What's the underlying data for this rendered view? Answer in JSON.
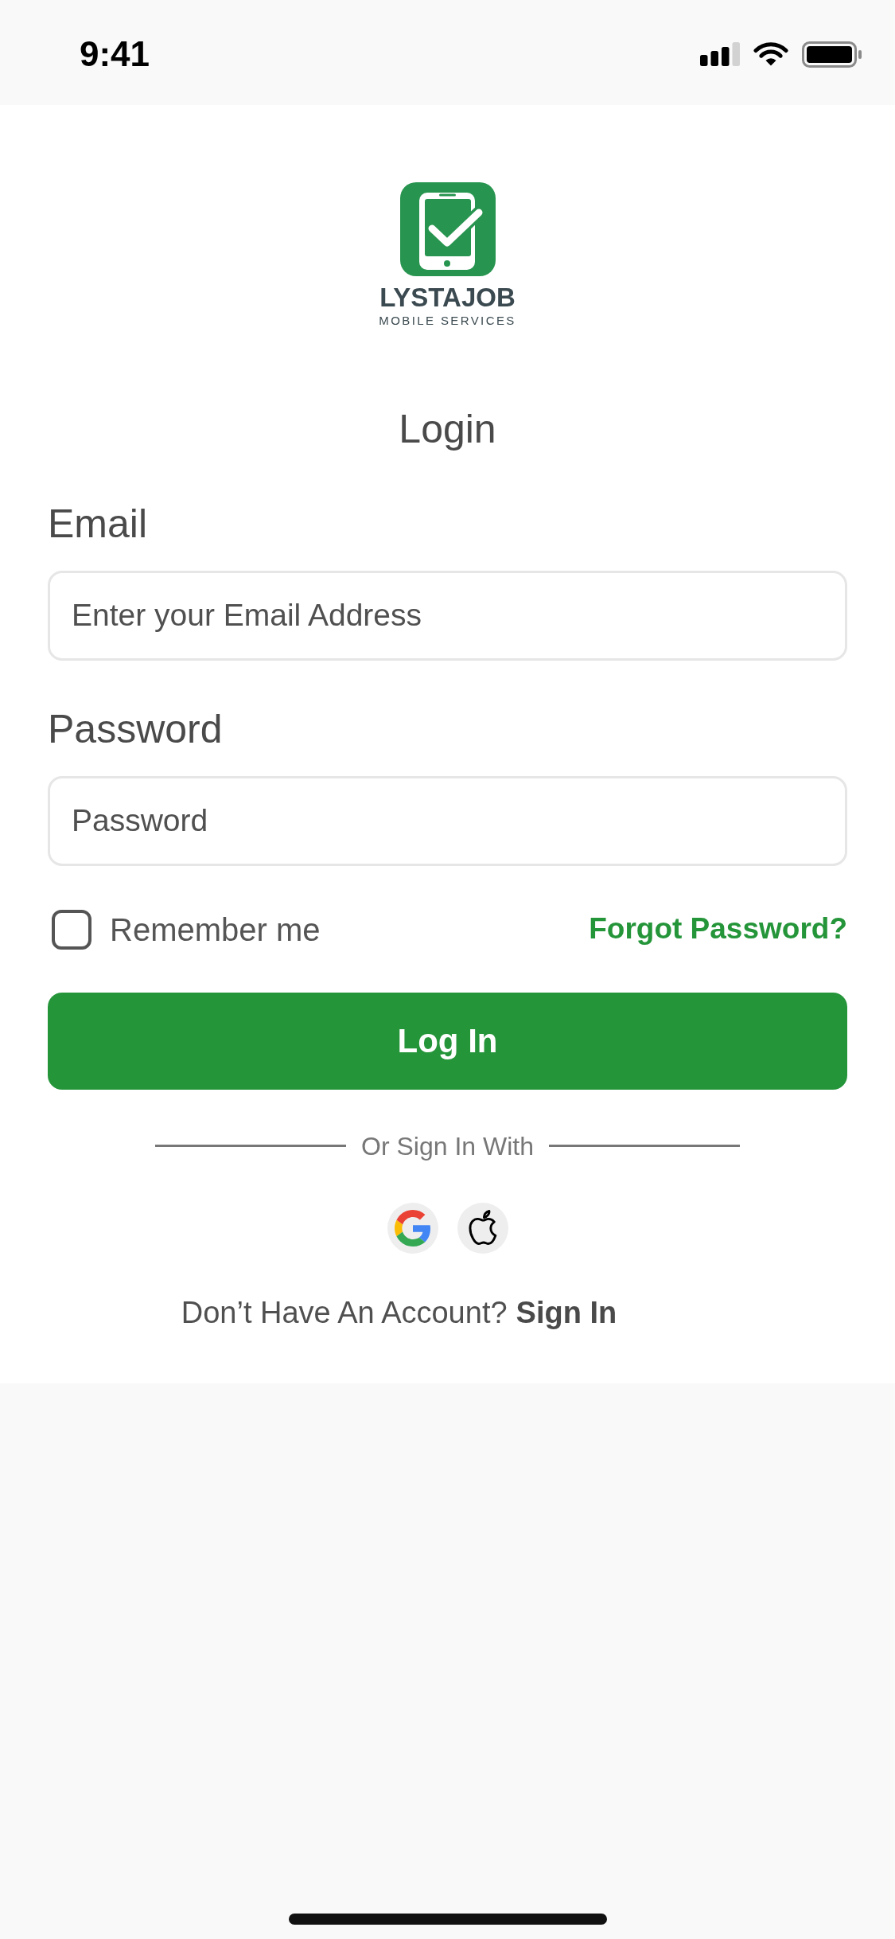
{
  "status_bar": {
    "time": "9:41"
  },
  "brand": {
    "name": "LYSTAJOB",
    "tagline": "MOBILE SERVICES"
  },
  "title": "Login",
  "fields": [
    {
      "label": "Email",
      "placeholder": "Enter your Email Address"
    },
    {
      "label": "Password",
      "placeholder": "Password"
    }
  ],
  "remember": {
    "label": "Remember me",
    "checked": false
  },
  "forgot_link": "Forgot Password?",
  "login_button": "Log In",
  "divider_text": "Or Sign In With",
  "social_buttons": [
    {
      "kind": "google"
    },
    {
      "kind": "apple"
    }
  ],
  "signup_prompt": {
    "text": "Don’t Have An Account?",
    "link": "Sign In"
  }
}
